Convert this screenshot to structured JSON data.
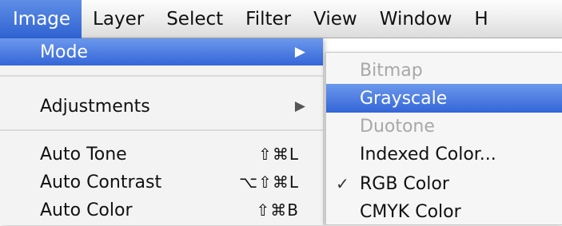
{
  "menubar": {
    "items": [
      {
        "label": "Image"
      },
      {
        "label": "Layer"
      },
      {
        "label": "Select"
      },
      {
        "label": "Filter"
      },
      {
        "label": "View"
      },
      {
        "label": "Window"
      },
      {
        "label": "H"
      }
    ]
  },
  "image_menu": {
    "mode": {
      "label": "Mode",
      "arrow": "▶"
    },
    "adjustments": {
      "label": "Adjustments",
      "arrow": "▶"
    },
    "auto_tone": {
      "label": "Auto Tone",
      "shortcut": "⇧⌘L"
    },
    "auto_contrast": {
      "label": "Auto Contrast",
      "shortcut": "⌥⇧⌘L"
    },
    "auto_color": {
      "label": "Auto Color",
      "shortcut": "⇧⌘B"
    }
  },
  "mode_submenu": {
    "items": [
      {
        "label": "Bitmap",
        "enabled": false
      },
      {
        "label": "Grayscale",
        "enabled": true,
        "highlighted": true
      },
      {
        "label": "Duotone",
        "enabled": false
      },
      {
        "label": "Indexed Color...",
        "enabled": true
      },
      {
        "label": "RGB Color",
        "enabled": true,
        "checked": true,
        "check": "✓"
      },
      {
        "label": "CMYK Color",
        "enabled": true
      }
    ]
  },
  "colors": {
    "highlight": "#3466d8",
    "disabled_text": "#a8a8a8",
    "menu_bg": "#f3f3f3"
  }
}
